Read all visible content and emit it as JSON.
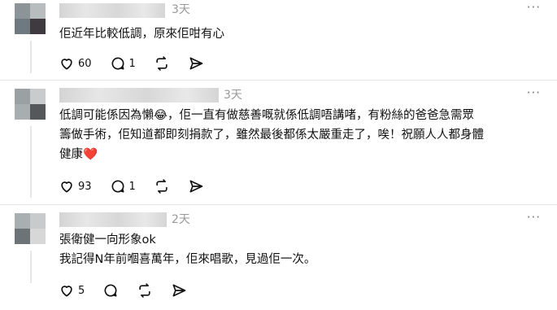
{
  "comments": [
    {
      "time": "3天",
      "text_lines": [
        "佢近年比較低調，原來佢咁有心"
      ],
      "likes": "60",
      "replies": "1",
      "more": "···"
    },
    {
      "time": "3天",
      "text_lines": [
        "低調可能係因為懶😂，佢一直有做慈善嘅就係低調唔講啫，有粉絲的爸爸急需眾",
        "籌做手術，佢知道都即刻捐款了，雖然最後都係太嚴重走了，唉！祝願人人都身體",
        "健康❤️"
      ],
      "likes": "93",
      "replies": "1",
      "more": "···"
    },
    {
      "time": "2天",
      "text_lines": [
        "張衛健一向形象ok",
        "我記得N年前嗰喜萬年，佢來唱歌，見過佢一次。"
      ],
      "likes": "5",
      "replies": "",
      "more": "···"
    }
  ],
  "icons": {
    "like": "heart-outline-icon",
    "reply": "speech-bubble-icon",
    "repost": "repost-arrows-icon",
    "share": "send-paper-plane-icon",
    "more": "more-dots-icon"
  },
  "colors": {
    "heart_emoji": "#e0245e",
    "timestamp": "#999999",
    "divider": "#e4e4e4"
  }
}
